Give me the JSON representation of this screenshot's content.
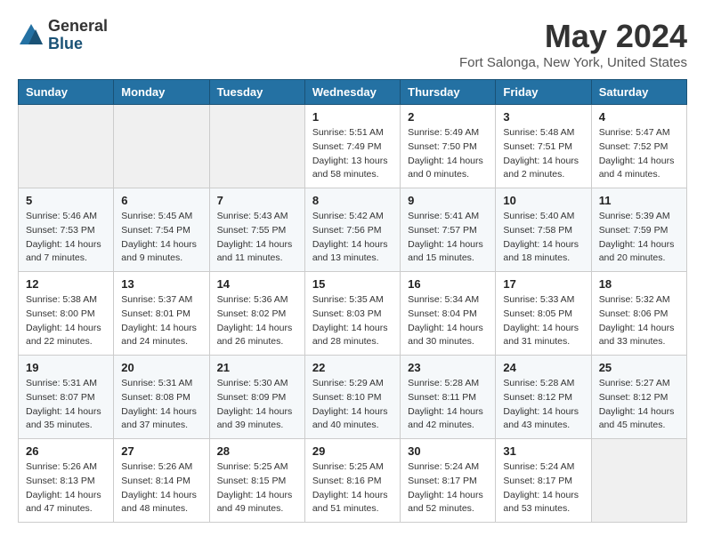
{
  "logo": {
    "general": "General",
    "blue": "Blue"
  },
  "title": "May 2024",
  "location": "Fort Salonga, New York, United States",
  "days_of_week": [
    "Sunday",
    "Monday",
    "Tuesday",
    "Wednesday",
    "Thursday",
    "Friday",
    "Saturday"
  ],
  "weeks": [
    [
      {
        "day": "",
        "sunrise": "",
        "sunset": "",
        "daylight": ""
      },
      {
        "day": "",
        "sunrise": "",
        "sunset": "",
        "daylight": ""
      },
      {
        "day": "",
        "sunrise": "",
        "sunset": "",
        "daylight": ""
      },
      {
        "day": "1",
        "sunrise": "Sunrise: 5:51 AM",
        "sunset": "Sunset: 7:49 PM",
        "daylight": "Daylight: 13 hours and 58 minutes."
      },
      {
        "day": "2",
        "sunrise": "Sunrise: 5:49 AM",
        "sunset": "Sunset: 7:50 PM",
        "daylight": "Daylight: 14 hours and 0 minutes."
      },
      {
        "day": "3",
        "sunrise": "Sunrise: 5:48 AM",
        "sunset": "Sunset: 7:51 PM",
        "daylight": "Daylight: 14 hours and 2 minutes."
      },
      {
        "day": "4",
        "sunrise": "Sunrise: 5:47 AM",
        "sunset": "Sunset: 7:52 PM",
        "daylight": "Daylight: 14 hours and 4 minutes."
      }
    ],
    [
      {
        "day": "5",
        "sunrise": "Sunrise: 5:46 AM",
        "sunset": "Sunset: 7:53 PM",
        "daylight": "Daylight: 14 hours and 7 minutes."
      },
      {
        "day": "6",
        "sunrise": "Sunrise: 5:45 AM",
        "sunset": "Sunset: 7:54 PM",
        "daylight": "Daylight: 14 hours and 9 minutes."
      },
      {
        "day": "7",
        "sunrise": "Sunrise: 5:43 AM",
        "sunset": "Sunset: 7:55 PM",
        "daylight": "Daylight: 14 hours and 11 minutes."
      },
      {
        "day": "8",
        "sunrise": "Sunrise: 5:42 AM",
        "sunset": "Sunset: 7:56 PM",
        "daylight": "Daylight: 14 hours and 13 minutes."
      },
      {
        "day": "9",
        "sunrise": "Sunrise: 5:41 AM",
        "sunset": "Sunset: 7:57 PM",
        "daylight": "Daylight: 14 hours and 15 minutes."
      },
      {
        "day": "10",
        "sunrise": "Sunrise: 5:40 AM",
        "sunset": "Sunset: 7:58 PM",
        "daylight": "Daylight: 14 hours and 18 minutes."
      },
      {
        "day": "11",
        "sunrise": "Sunrise: 5:39 AM",
        "sunset": "Sunset: 7:59 PM",
        "daylight": "Daylight: 14 hours and 20 minutes."
      }
    ],
    [
      {
        "day": "12",
        "sunrise": "Sunrise: 5:38 AM",
        "sunset": "Sunset: 8:00 PM",
        "daylight": "Daylight: 14 hours and 22 minutes."
      },
      {
        "day": "13",
        "sunrise": "Sunrise: 5:37 AM",
        "sunset": "Sunset: 8:01 PM",
        "daylight": "Daylight: 14 hours and 24 minutes."
      },
      {
        "day": "14",
        "sunrise": "Sunrise: 5:36 AM",
        "sunset": "Sunset: 8:02 PM",
        "daylight": "Daylight: 14 hours and 26 minutes."
      },
      {
        "day": "15",
        "sunrise": "Sunrise: 5:35 AM",
        "sunset": "Sunset: 8:03 PM",
        "daylight": "Daylight: 14 hours and 28 minutes."
      },
      {
        "day": "16",
        "sunrise": "Sunrise: 5:34 AM",
        "sunset": "Sunset: 8:04 PM",
        "daylight": "Daylight: 14 hours and 30 minutes."
      },
      {
        "day": "17",
        "sunrise": "Sunrise: 5:33 AM",
        "sunset": "Sunset: 8:05 PM",
        "daylight": "Daylight: 14 hours and 31 minutes."
      },
      {
        "day": "18",
        "sunrise": "Sunrise: 5:32 AM",
        "sunset": "Sunset: 8:06 PM",
        "daylight": "Daylight: 14 hours and 33 minutes."
      }
    ],
    [
      {
        "day": "19",
        "sunrise": "Sunrise: 5:31 AM",
        "sunset": "Sunset: 8:07 PM",
        "daylight": "Daylight: 14 hours and 35 minutes."
      },
      {
        "day": "20",
        "sunrise": "Sunrise: 5:31 AM",
        "sunset": "Sunset: 8:08 PM",
        "daylight": "Daylight: 14 hours and 37 minutes."
      },
      {
        "day": "21",
        "sunrise": "Sunrise: 5:30 AM",
        "sunset": "Sunset: 8:09 PM",
        "daylight": "Daylight: 14 hours and 39 minutes."
      },
      {
        "day": "22",
        "sunrise": "Sunrise: 5:29 AM",
        "sunset": "Sunset: 8:10 PM",
        "daylight": "Daylight: 14 hours and 40 minutes."
      },
      {
        "day": "23",
        "sunrise": "Sunrise: 5:28 AM",
        "sunset": "Sunset: 8:11 PM",
        "daylight": "Daylight: 14 hours and 42 minutes."
      },
      {
        "day": "24",
        "sunrise": "Sunrise: 5:28 AM",
        "sunset": "Sunset: 8:12 PM",
        "daylight": "Daylight: 14 hours and 43 minutes."
      },
      {
        "day": "25",
        "sunrise": "Sunrise: 5:27 AM",
        "sunset": "Sunset: 8:12 PM",
        "daylight": "Daylight: 14 hours and 45 minutes."
      }
    ],
    [
      {
        "day": "26",
        "sunrise": "Sunrise: 5:26 AM",
        "sunset": "Sunset: 8:13 PM",
        "daylight": "Daylight: 14 hours and 47 minutes."
      },
      {
        "day": "27",
        "sunrise": "Sunrise: 5:26 AM",
        "sunset": "Sunset: 8:14 PM",
        "daylight": "Daylight: 14 hours and 48 minutes."
      },
      {
        "day": "28",
        "sunrise": "Sunrise: 5:25 AM",
        "sunset": "Sunset: 8:15 PM",
        "daylight": "Daylight: 14 hours and 49 minutes."
      },
      {
        "day": "29",
        "sunrise": "Sunrise: 5:25 AM",
        "sunset": "Sunset: 8:16 PM",
        "daylight": "Daylight: 14 hours and 51 minutes."
      },
      {
        "day": "30",
        "sunrise": "Sunrise: 5:24 AM",
        "sunset": "Sunset: 8:17 PM",
        "daylight": "Daylight: 14 hours and 52 minutes."
      },
      {
        "day": "31",
        "sunrise": "Sunrise: 5:24 AM",
        "sunset": "Sunset: 8:17 PM",
        "daylight": "Daylight: 14 hours and 53 minutes."
      },
      {
        "day": "",
        "sunrise": "",
        "sunset": "",
        "daylight": ""
      }
    ]
  ]
}
